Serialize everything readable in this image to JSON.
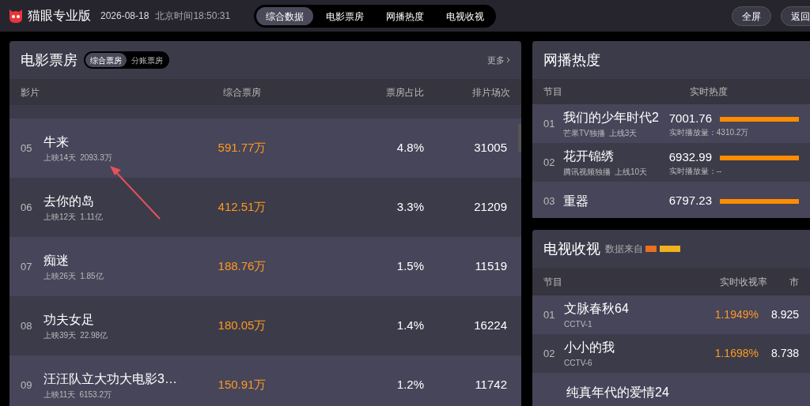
{
  "header": {
    "brand": "猫眼专业版",
    "date": "2026-08-18",
    "time": "北京时间18:50:31",
    "nav": [
      {
        "label": "综合数据",
        "selected": true
      },
      {
        "label": "电影票房",
        "selected": false
      },
      {
        "label": "网播热度",
        "selected": false
      },
      {
        "label": "电视收视",
        "selected": false
      }
    ],
    "buttons": [
      "全屏",
      "返回"
    ]
  },
  "box_office": {
    "title": "电影票房",
    "tabs": [
      {
        "label": "综合票房",
        "selected": true
      },
      {
        "label": "分账票房",
        "selected": false
      }
    ],
    "more": "更多",
    "columns": [
      "影片",
      "综合票房",
      "票房占比",
      "排片场次"
    ],
    "rows": [
      {
        "rank": "05",
        "name": "牛来",
        "days": "上映14天",
        "total": "2093.3万",
        "box": "591.77万",
        "share": "4.8%",
        "shows": "31005"
      },
      {
        "rank": "06",
        "name": "去你的岛",
        "days": "上映12天",
        "total": "1.11亿",
        "box": "412.51万",
        "share": "3.3%",
        "shows": "21209"
      },
      {
        "rank": "07",
        "name": "痴迷",
        "days": "上映26天",
        "total": "1.85亿",
        "box": "188.76万",
        "share": "1.5%",
        "shows": "11519"
      },
      {
        "rank": "08",
        "name": "功夫女足",
        "days": "上映39天",
        "total": "22.98亿",
        "box": "180.05万",
        "share": "1.4%",
        "shows": "16224"
      },
      {
        "rank": "09",
        "name": "汪汪队立大功大电影3…",
        "days": "上映11天",
        "total": "6153.2万",
        "box": "150.91万",
        "share": "1.2%",
        "shows": "11742"
      }
    ]
  },
  "web_heat": {
    "title": "网播热度",
    "columns": [
      "节目",
      "实时热度"
    ],
    "rows": [
      {
        "rank": "01",
        "name": "我们的少年时代2",
        "platform": "芒果TV独播",
        "online": "上线3天",
        "heat": "7001.76",
        "plays": "实时播放量：4310.2万"
      },
      {
        "rank": "02",
        "name": "花开锦绣",
        "platform": "腾讯视频独播",
        "online": "上线10天",
        "heat": "6932.99",
        "plays": "实时播放量：--"
      },
      {
        "rank": "03",
        "name": "重器",
        "heat": "6797.23"
      }
    ]
  },
  "tv": {
    "title": "电视收视",
    "source": "数据来自",
    "columns": [
      "节目",
      "实时收视率",
      "市"
    ],
    "rows": [
      {
        "rank": "01",
        "name": "文脉春秋64",
        "channel": "CCTV-1",
        "rating": "1.1949%",
        "column_3": "8.925"
      },
      {
        "rank": "02",
        "name": "小小的我",
        "channel": "CCTV-6",
        "rating": "1.1698%",
        "column_3": "8.738"
      },
      {
        "name": "纯真年代的爱情24"
      }
    ]
  }
}
